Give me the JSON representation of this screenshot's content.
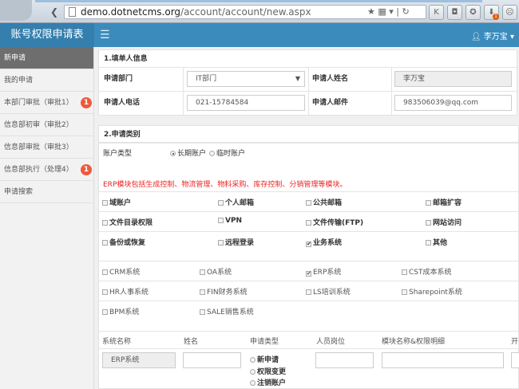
{
  "browser": {
    "url_host": "demo.dotnetcms.org",
    "url_path": "/account/account/new.aspx",
    "ext_badge": "1"
  },
  "header": {
    "brand": "账号权限申请表",
    "user": "李万宝"
  },
  "sidebar": {
    "items": [
      {
        "label": "新申请",
        "active": true
      },
      {
        "label": "我的申请"
      },
      {
        "label": "本部门审批（审批1）",
        "badge": "1"
      },
      {
        "label": "信息部初审（审批2）"
      },
      {
        "label": "信息部审批（审批3）"
      },
      {
        "label": "信息部执行（处理4）",
        "badge": "1"
      },
      {
        "label": "申请搜索"
      }
    ]
  },
  "section1": {
    "title": "1.填单人信息",
    "dept_label": "申请部门",
    "dept_value": "IT部门",
    "name_label": "申请人姓名",
    "name_value": "李万宝",
    "phone_label": "申请人电话",
    "phone_value": "021-15784584",
    "email_label": "申请人邮件",
    "email_value": "983506039@qq.com"
  },
  "section2": {
    "title": "2.申请类别",
    "account_type_label": "账户类型",
    "account_types": [
      {
        "label": "长期账户",
        "checked": true
      },
      {
        "label": "临时账户",
        "checked": false
      }
    ],
    "notice": "ERP模块包括生成控制、物流管理、物料采购、库存控制、分销管理等模块。",
    "categories": [
      [
        {
          "label": "域账户"
        },
        {
          "label": "个人邮箱"
        },
        {
          "label": "公共邮箱"
        },
        {
          "label": "邮箱扩容"
        }
      ],
      [
        {
          "label": "文件目录权限"
        },
        {
          "label": "VPN"
        },
        {
          "label": "文件传输(FTP)"
        },
        {
          "label": "网站访问"
        }
      ],
      [
        {
          "label": "备份或恢复"
        },
        {
          "label": "远程登录"
        },
        {
          "label": "业务系统",
          "checked": true
        },
        {
          "label": "其他"
        }
      ]
    ],
    "systems": [
      [
        {
          "label": "CRM系统"
        },
        {
          "label": "OA系统"
        },
        {
          "label": "ERP系统",
          "checked": true
        },
        {
          "label": "CST成本系统"
        }
      ],
      [
        {
          "label": "HR人事系统"
        },
        {
          "label": "FIN财务系统"
        },
        {
          "label": "LS培训系统"
        },
        {
          "label": "Sharepoint系统"
        }
      ],
      [
        {
          "label": "BPM系统"
        },
        {
          "label": "SALE销售系统"
        }
      ]
    ],
    "table": {
      "headers": [
        "系统名称",
        "姓名",
        "申请类型",
        "人员岗位",
        "模块名称&权限明细",
        "开"
      ],
      "row": {
        "system": "ERP系统",
        "request_types": [
          "新申请",
          "权限变更",
          "注销账户"
        ]
      }
    }
  }
}
